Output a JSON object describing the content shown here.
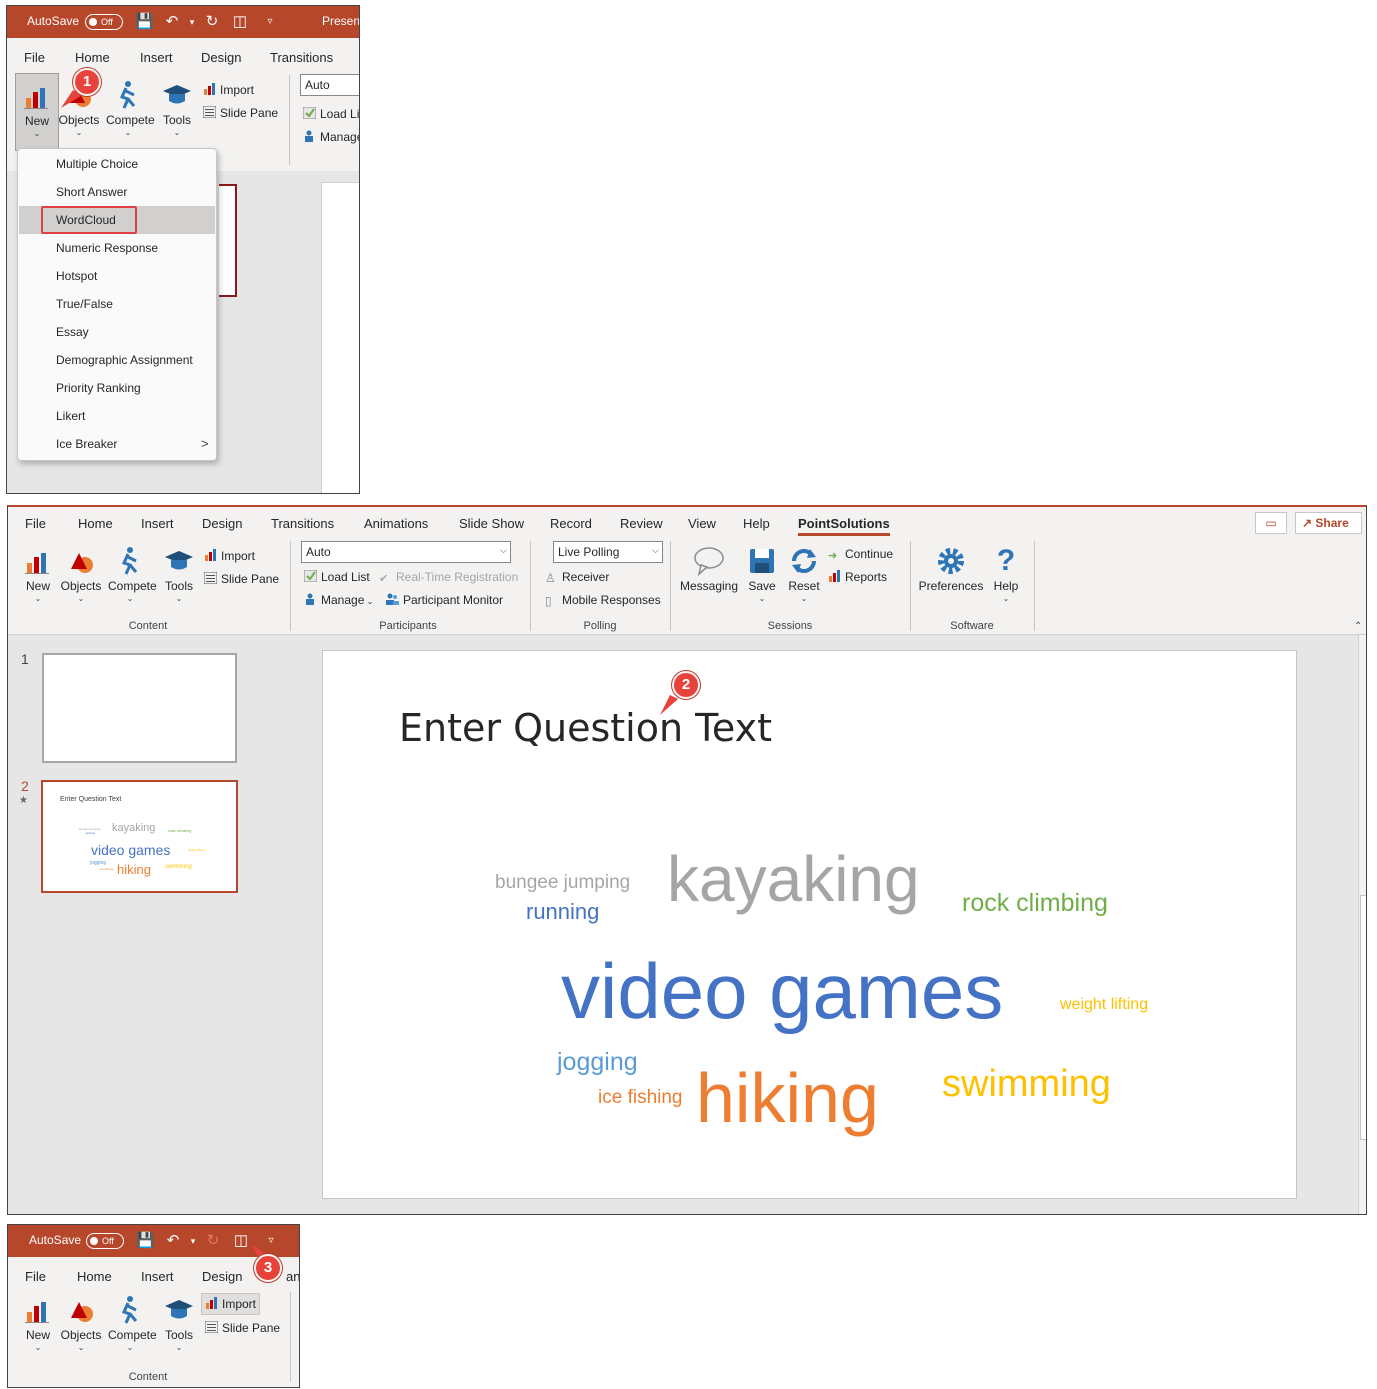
{
  "panel1": {
    "titlebar": {
      "autosave_label": "AutoSave",
      "toggle_label": "Off",
      "doc_title": "Present"
    },
    "tabs": [
      "File",
      "Home",
      "Insert",
      "Design",
      "Transitions"
    ],
    "ribbon": {
      "big_buttons": [
        "New",
        "Objects",
        "Compete",
        "Tools"
      ],
      "small_buttons": [
        "Import",
        "Slide Pane"
      ],
      "combo_value": "Auto",
      "right_buttons": [
        "Load List",
        "Manage"
      ]
    },
    "callout": "1",
    "new_menu": {
      "items": [
        "Multiple Choice",
        "Short Answer",
        "WordCloud",
        "Numeric Response",
        "Hotspot",
        "True/False",
        "Essay",
        "Demographic Assignment",
        "Priority Ranking",
        "Likert",
        "Ice Breaker"
      ],
      "highlighted": "WordCloud",
      "submenu_arrow": ">"
    }
  },
  "panel2": {
    "tabs": [
      "File",
      "Home",
      "Insert",
      "Design",
      "Transitions",
      "Animations",
      "Slide Show",
      "Record",
      "Review",
      "View",
      "Help",
      "PointSolutions"
    ],
    "active_tab": "PointSolutions",
    "share_label": "Share",
    "content_group": {
      "label": "Content",
      "big_buttons": [
        "New",
        "Objects",
        "Compete",
        "Tools"
      ],
      "small_buttons": [
        "Import",
        "Slide Pane"
      ]
    },
    "participants_group": {
      "label": "Participants",
      "combo_value": "Auto",
      "load_list": "Load List",
      "realtime": "Real-Time Registration",
      "manage": "Manage",
      "monitor": "Participant Monitor"
    },
    "polling_group": {
      "label": "Polling",
      "combo_value": "Live Polling",
      "receiver": "Receiver",
      "mobile": "Mobile Responses"
    },
    "sessions_group": {
      "label": "Sessions",
      "messaging": "Messaging",
      "save": "Save",
      "reset": "Reset",
      "continue": "Continue",
      "reports": "Reports"
    },
    "software_group": {
      "label": "Software",
      "preferences": "Preferences",
      "help": "Help"
    },
    "slides": [
      {
        "number": "1"
      },
      {
        "number": "2",
        "star": "★",
        "title": "Enter Question Text"
      }
    ],
    "slide_title": "Enter Question Text",
    "callout": "2",
    "wordcloud": [
      {
        "word": "bungee jumping",
        "color": "#a6a6a6"
      },
      {
        "word": "running",
        "color": "#4472c4"
      },
      {
        "word": "kayaking",
        "color": "#a5a5a5"
      },
      {
        "word": "rock climbing",
        "color": "#70ad47"
      },
      {
        "word": "video games",
        "color": "#4472c4"
      },
      {
        "word": "weight lifting",
        "color": "#ffc000"
      },
      {
        "word": "jogging",
        "color": "#5b9bd5"
      },
      {
        "word": "ice fishing",
        "color": "#ed7d31"
      },
      {
        "word": "hiking",
        "color": "#ed7d31"
      },
      {
        "word": "swimming",
        "color": "#ffc000"
      }
    ]
  },
  "panel3": {
    "titlebar": {
      "autosave_label": "AutoSave",
      "toggle_label": "Off"
    },
    "tabs": [
      "File",
      "Home",
      "Insert",
      "Design",
      "ans"
    ],
    "ribbon": {
      "big_buttons": [
        "New",
        "Objects",
        "Compete",
        "Tools"
      ],
      "small_buttons": [
        "Import",
        "Slide Pane"
      ],
      "group_label": "Content"
    },
    "callout": "3"
  },
  "colors": {
    "accent": "#b7472a",
    "callout": "#e8433a",
    "highlight_box": "#e04040"
  }
}
